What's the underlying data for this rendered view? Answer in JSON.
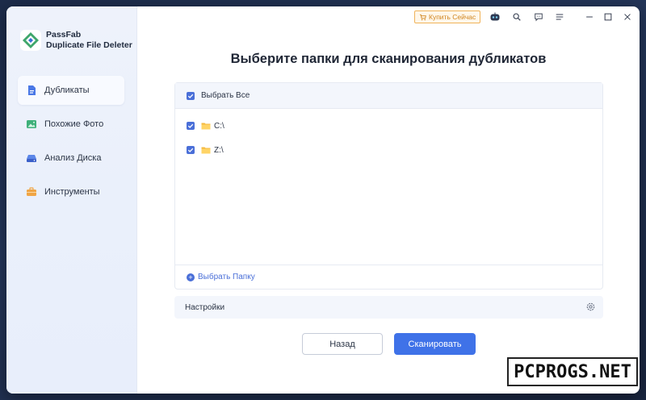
{
  "app": {
    "name_line1": "PassFab",
    "name_line2": "Duplicate File Deleter"
  },
  "sidebar": {
    "items": [
      {
        "label": "Дубликаты",
        "icon": "document-icon",
        "active": true
      },
      {
        "label": "Похожие Фото",
        "icon": "image-icon",
        "active": false
      },
      {
        "label": "Анализ Диска",
        "icon": "disk-icon",
        "active": false
      },
      {
        "label": "Инструменты",
        "icon": "toolbox-icon",
        "active": false
      }
    ]
  },
  "topbar": {
    "buy_label": "Купить Сейчас"
  },
  "main": {
    "title": "Выберите папки для сканирования дубликатов",
    "select_all_label": "Выбрать Все",
    "folders": [
      {
        "label": "C:\\"
      },
      {
        "label": "Z:\\"
      }
    ],
    "add_folder_label": "Выбрать Папку",
    "settings_label": "Настройки",
    "back_label": "Назад",
    "scan_label": "Сканировать"
  },
  "watermark": {
    "text": "PCPROGS.NET"
  },
  "colors": {
    "accent": "#3f72e8",
    "checkbox": "#4a6fd8",
    "buy_border": "#f0b35a",
    "buy_text": "#d0851f"
  }
}
